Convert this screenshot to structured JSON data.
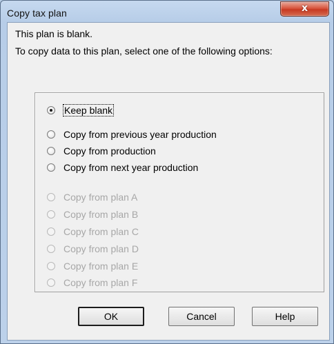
{
  "window": {
    "title": "Copy tax plan",
    "close_glyph": "x"
  },
  "message": {
    "line1": "This plan is blank.",
    "line2": "To copy data to this plan, select one of the following options:"
  },
  "options": [
    {
      "label": "Keep blank",
      "selected": true,
      "enabled": true
    },
    {
      "label": "Copy from previous year production",
      "selected": false,
      "enabled": true
    },
    {
      "label": "Copy from production",
      "selected": false,
      "enabled": true
    },
    {
      "label": "Copy from next year production",
      "selected": false,
      "enabled": true
    },
    {
      "label": "Copy from plan A",
      "selected": false,
      "enabled": false
    },
    {
      "label": "Copy from plan B",
      "selected": false,
      "enabled": false
    },
    {
      "label": "Copy from plan C",
      "selected": false,
      "enabled": false
    },
    {
      "label": "Copy from plan D",
      "selected": false,
      "enabled": false
    },
    {
      "label": "Copy from plan E",
      "selected": false,
      "enabled": false
    },
    {
      "label": "Copy from plan F",
      "selected": false,
      "enabled": false
    }
  ],
  "buttons": {
    "ok": "OK",
    "cancel": "Cancel",
    "help": "Help"
  }
}
